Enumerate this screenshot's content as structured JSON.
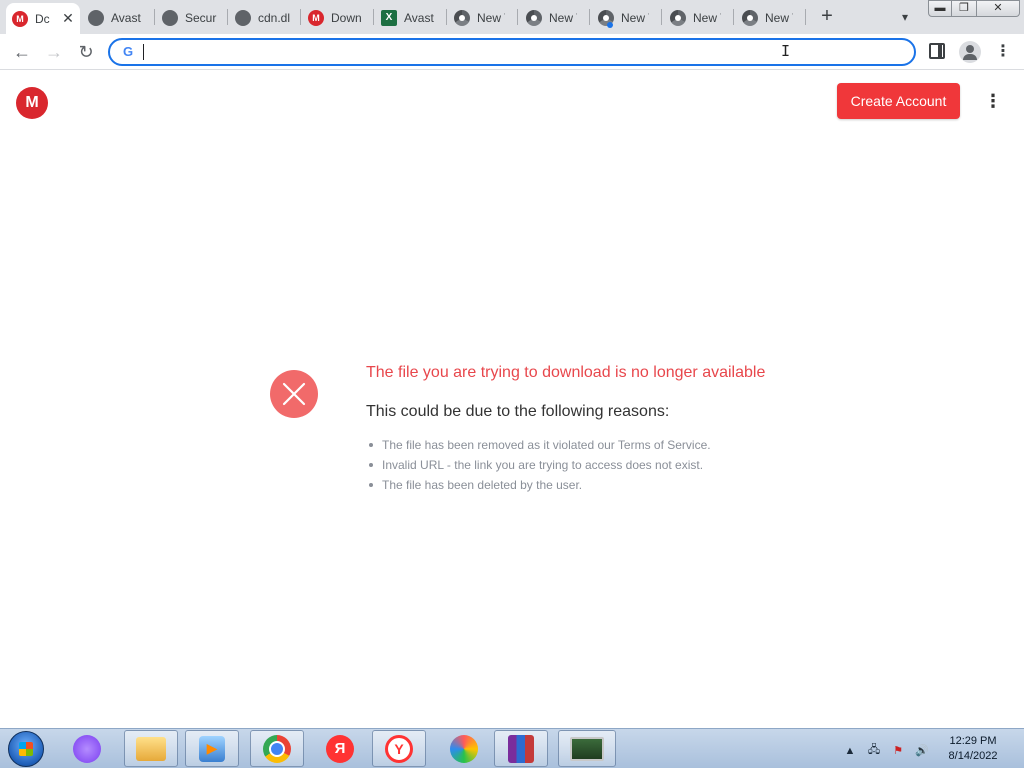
{
  "tabs": [
    {
      "label": "Dc",
      "favicon": "mega-icon",
      "active": true
    },
    {
      "label": "Avast",
      "favicon": "avast-gear-icon"
    },
    {
      "label": "Secur",
      "favicon": "globe-icon"
    },
    {
      "label": "cdn.dl",
      "favicon": "globe-icon"
    },
    {
      "label": "Down",
      "favicon": "mega-icon"
    },
    {
      "label": "Avast",
      "favicon": "sheets-icon"
    },
    {
      "label": "New T",
      "favicon": "chrome-icon"
    },
    {
      "label": "New T",
      "favicon": "chrome-icon"
    },
    {
      "label": "New T",
      "favicon": "chrome-icon"
    },
    {
      "label": "New T",
      "favicon": "chrome-icon"
    },
    {
      "label": "New T",
      "favicon": "chrome-icon"
    }
  ],
  "toolbar": {
    "omnibox_value": "",
    "omnibox_icon": "G"
  },
  "page": {
    "logo_letter": "M",
    "create_account_label": "Create Account",
    "error_title": "The file you are trying to download is no longer available",
    "error_subtitle": "This could be due to the following reasons:",
    "reasons": [
      "The file has been removed as it violated our Terms of Service.",
      "Invalid URL - the link you are trying to access does not exist.",
      "The file has been deleted by the user."
    ]
  },
  "taskbar": {
    "clock_time": "12:29 PM",
    "clock_date": "8/14/2022",
    "yandex_letter": "Я",
    "ybrowser_letter": "Y"
  },
  "colors": {
    "mega_red": "#d9272e",
    "create_button": "#f0373a",
    "error_title": "#e8474c",
    "error_icon": "#f16a6a",
    "omnibox_focus": "#1a73e8"
  }
}
